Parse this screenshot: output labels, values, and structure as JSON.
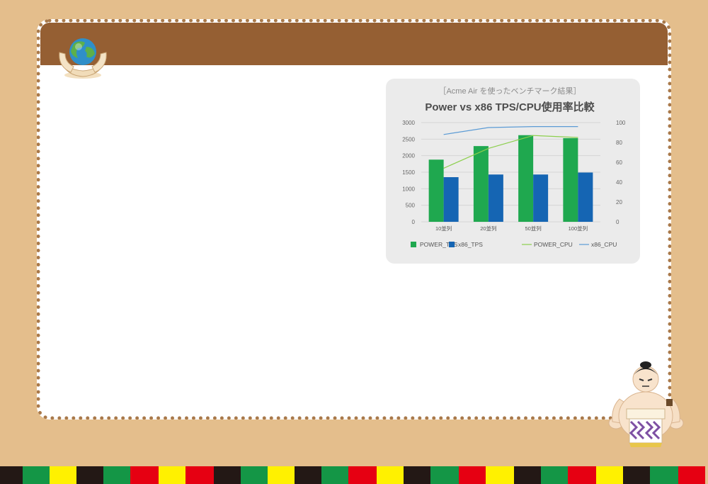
{
  "chart_data": {
    "type": "bar",
    "subtitle": "［Acme Air を使ったベンチマーク結果］",
    "title": "Power vs x86 TPS/CPU使用率比較",
    "categories": [
      "10並列",
      "20並列",
      "50並列",
      "100並列"
    ],
    "y_left": {
      "ticks": [
        "3000",
        "2500",
        "2000",
        "1500",
        "1000",
        "500",
        "0"
      ],
      "ylim": [
        0,
        3000
      ]
    },
    "y_right": {
      "ticks": [
        "100",
        "80",
        "60",
        "40",
        "20",
        "0"
      ],
      "ylim": [
        0,
        100
      ]
    },
    "series": [
      {
        "name": "POWER_TPS",
        "type": "bar",
        "axis": "left",
        "color": "#1fa84f",
        "values": [
          1880,
          2290,
          2620,
          2530
        ]
      },
      {
        "name": "x86_TPS",
        "type": "bar",
        "axis": "left",
        "color": "#1565b3",
        "values": [
          1350,
          1430,
          1430,
          1490
        ]
      },
      {
        "name": "POWER_CPU",
        "type": "line",
        "axis": "right",
        "color": "#8ccf4d",
        "values": [
          54,
          74,
          87,
          85
        ]
      },
      {
        "name": "x86_CPU",
        "type": "line",
        "axis": "right",
        "color": "#5b9bd5",
        "values": [
          88,
          95,
          96,
          96
        ]
      }
    ],
    "grid": true,
    "legend_position": "bottom"
  },
  "decor": {
    "globe": "globe-in-hands-icon",
    "mascot": "sumo-wrestler-icon",
    "colors": {
      "background": "#e4be8c",
      "header": "#955f33",
      "stripe_palette": [
        "#231815",
        "#149646",
        "#fff100",
        "#e60012"
      ]
    }
  }
}
